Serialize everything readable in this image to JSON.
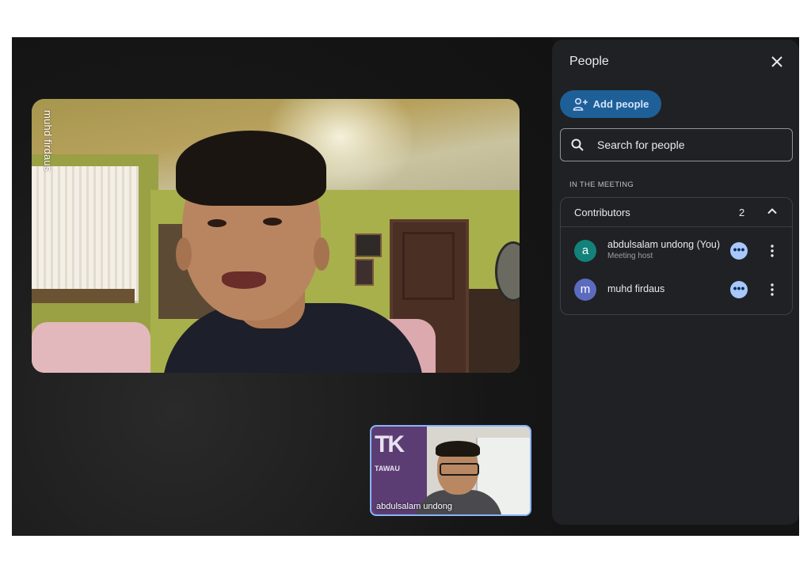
{
  "main_tile": {
    "name": "muhd firdaus"
  },
  "self_tile": {
    "name": "abdulsalam undong",
    "banner_text": "TK",
    "banner_subtext": "TAWAU"
  },
  "panel": {
    "title": "People",
    "add_people_label": "Add people",
    "search_placeholder": "Search for people",
    "section_label": "IN THE MEETING",
    "group": {
      "title": "Contributors",
      "count": "2",
      "participants": [
        {
          "initial": "a",
          "name": "abdulsalam undong (You)",
          "role": "Meeting host",
          "avatar_color": "#12827a"
        },
        {
          "initial": "m",
          "name": "muhd firdaus",
          "role": "",
          "avatar_color": "#5c6bc0"
        }
      ]
    }
  },
  "colors": {
    "accent": "#8ab4f8",
    "add_button": "#1e5f97",
    "panel_bg": "#202124"
  },
  "icons": [
    "close-icon",
    "add-person-icon",
    "search-icon",
    "chevron-up-icon",
    "more-options-icon",
    "kebab-menu-icon"
  ]
}
